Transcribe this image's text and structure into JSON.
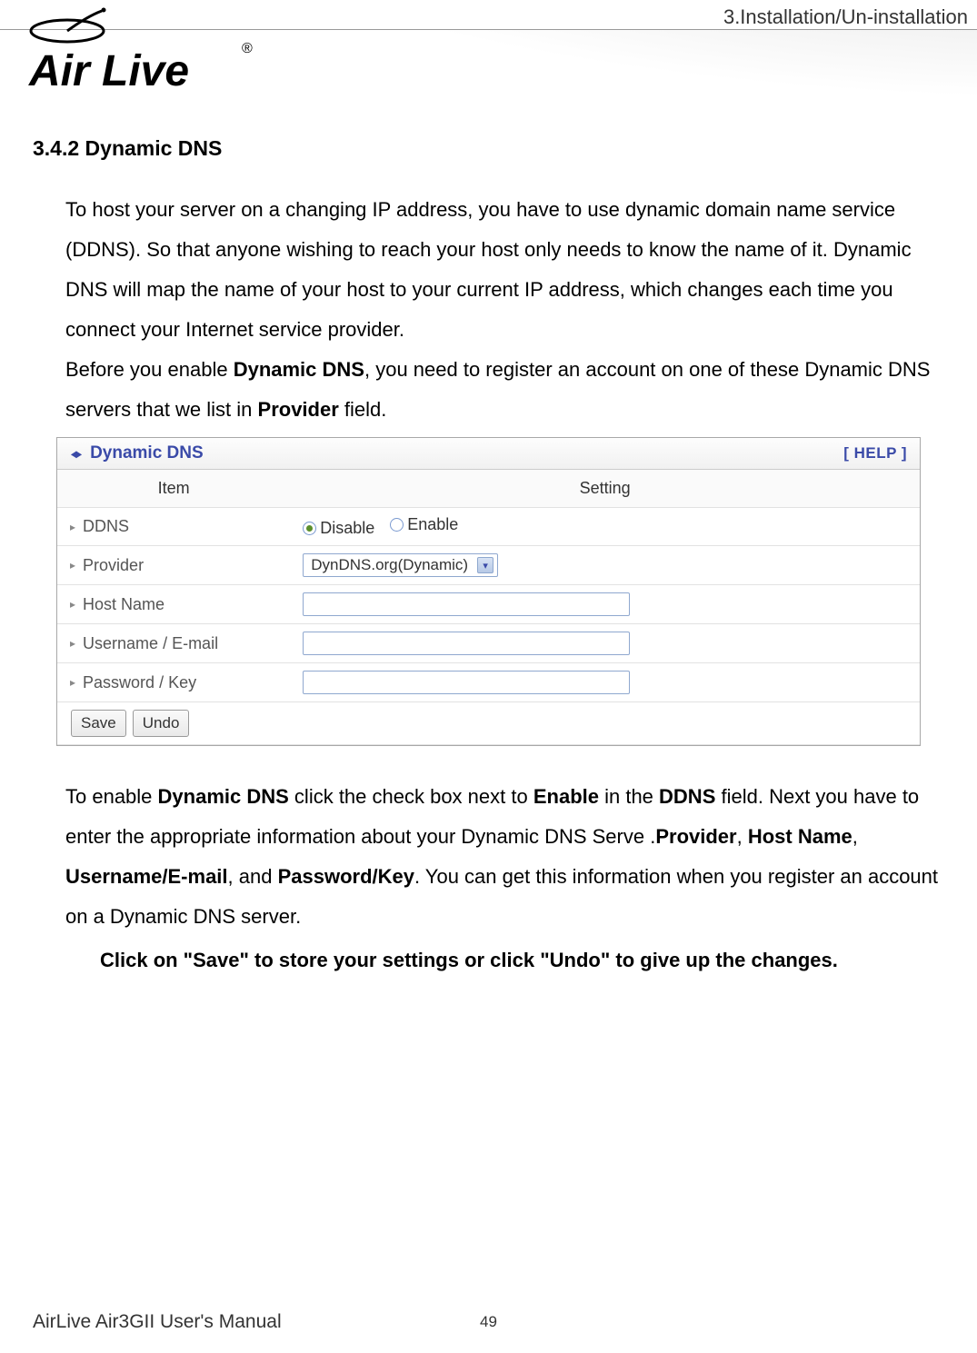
{
  "header": {
    "breadcrumb": "3.Installation/Un-installation",
    "logo_text": "Air Live",
    "logo_trademark": "®"
  },
  "section": {
    "heading": "3.4.2 Dynamic DNS",
    "para1_pre": "To host your server on a changing IP address, you have to use dynamic domain name service (DDNS). So that anyone wishing to reach your host only needs to know the name of it. Dynamic DNS will map the name of your host to your current IP address, which changes each time you connect your Internet service provider.",
    "para1_line2_pre": "Before you enable ",
    "para1_bold1": "Dynamic DNS",
    "para1_line2_mid": ", you need to register an account on one of these Dynamic DNS servers that we list in ",
    "para1_bold2": "Provider",
    "para1_line2_post": " field."
  },
  "config": {
    "title": "Dynamic DNS",
    "help": "[ HELP ]",
    "columns": {
      "item": "Item",
      "setting": "Setting"
    },
    "rows": {
      "ddns": {
        "label": "DDNS",
        "disable": "Disable",
        "enable": "Enable",
        "selected": "disable"
      },
      "provider": {
        "label": "Provider",
        "value": "DynDNS.org(Dynamic)"
      },
      "hostname": {
        "label": "Host Name",
        "value": ""
      },
      "username": {
        "label": "Username / E-mail",
        "value": ""
      },
      "password": {
        "label": "Password / Key",
        "value": ""
      }
    },
    "buttons": {
      "save": "Save",
      "undo": "Undo"
    }
  },
  "section2": {
    "p_pre": "To enable ",
    "p_b1": "Dynamic DNS",
    "p_mid1": " click the check box next to ",
    "p_b2": "Enable",
    "p_mid2": " in the ",
    "p_b3": "DDNS",
    "p_mid3": " field. Next you have to enter the appropriate information about your Dynamic DNS Serve .",
    "p_b4": "Provider",
    "p_mid4": ", ",
    "p_b5": "Host Name",
    "p_mid5": ", ",
    "p_b6": "Username/E-mail",
    "p_mid6": ", and ",
    "p_b7": "Password/Key",
    "p_post": ". You can get this information when you register an account on a Dynamic DNS server.",
    "p_final": "Click on \"Save\" to store your settings or click \"Undo\" to give up the changes."
  },
  "footer": {
    "manual": "AirLive Air3GII User's Manual",
    "page": "49"
  }
}
